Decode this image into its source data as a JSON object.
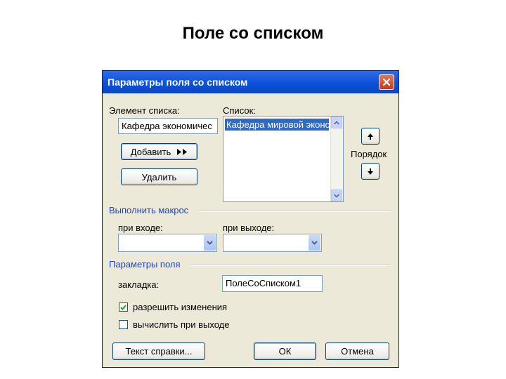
{
  "slide": {
    "title": "Поле со списком"
  },
  "dialog": {
    "title": "Параметры поля со списком",
    "element_label": "Элемент списка:",
    "element_value": "Кафедра экономичес",
    "add_button": "Добавить",
    "remove_button": "Удалить",
    "list_label": "Список:",
    "list_items": [
      "Кафедра мировой экономики"
    ],
    "order_label": "Порядок",
    "macro_group": "Выполнить макрос",
    "on_entry_label": "при входе:",
    "on_entry_value": "",
    "on_exit_label": "при выходе:",
    "on_exit_value": "",
    "field_params_group": "Параметры поля",
    "bookmark_label": "закладка:",
    "bookmark_value": "ПолеСоСписком1",
    "allow_changes_label": "разрешить изменения",
    "allow_changes_checked": true,
    "calc_on_exit_label": "вычислить при выходе",
    "calc_on_exit_checked": false,
    "help_text_button": "Текст справки...",
    "ok_button": "ОК",
    "cancel_button": "Отмена"
  },
  "colors": {
    "titlebar": "#0b52d8",
    "group_label": "#1c46b8",
    "selection": "#316ac5",
    "close_button": "#c63a1c"
  }
}
